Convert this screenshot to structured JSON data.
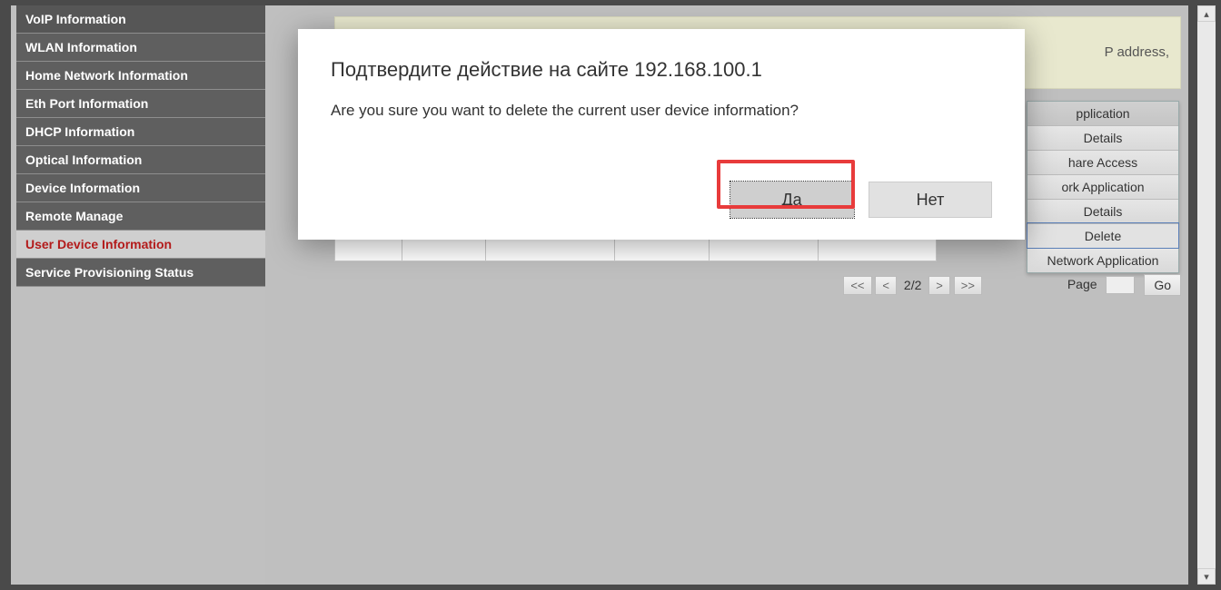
{
  "sidebar": {
    "items": [
      {
        "label": "VoIP Information"
      },
      {
        "label": "WLAN Information"
      },
      {
        "label": "Home Network Information"
      },
      {
        "label": "Eth Port Information"
      },
      {
        "label": "DHCP Information"
      },
      {
        "label": "Optical Information"
      },
      {
        "label": "Device Information"
      },
      {
        "label": "Remote Manage"
      },
      {
        "label": "User Device Information"
      },
      {
        "label": "Service Provisioning Status"
      }
    ],
    "selected_index": 8
  },
  "notice": {
    "text_fragment": "P address,"
  },
  "context_menu": {
    "header": "pplication",
    "items": [
      "Details",
      "hare Access",
      "ork Application",
      "Details",
      "Delete",
      "Network Application"
    ],
    "selected_index": 4
  },
  "pager": {
    "first": "<<",
    "prev": "<",
    "label": "2/2",
    "next": ">",
    "last": ">>",
    "page_label": "Page",
    "go": "Go"
  },
  "dialog": {
    "title": "Подтвердите действие на сайте 192.168.100.1",
    "message": "Are you sure you want to delete the current user device information?",
    "yes": "Да",
    "no": "Нет"
  }
}
